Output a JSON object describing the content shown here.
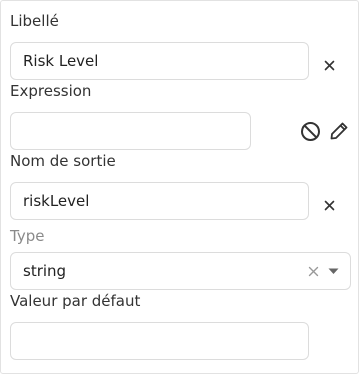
{
  "fields": {
    "label": {
      "title": "Libellé",
      "value": "Risk Level"
    },
    "expression": {
      "title": "Expression",
      "value": ""
    },
    "output_name": {
      "title": "Nom de sortie",
      "value": "riskLevel"
    },
    "type": {
      "title": "Type",
      "selected": "string"
    },
    "default_value": {
      "title": "Valeur par défaut",
      "value": ""
    }
  },
  "icons": {
    "clear_label": "close-icon",
    "disable_expression": "ban-icon",
    "edit_expression": "pencil-icon",
    "clear_output_name": "close-icon",
    "clear_type": "close-icon",
    "open_type": "caret-down-icon"
  },
  "colors": {
    "text": "#333333",
    "muted_label": "#8a8a8a",
    "border": "#dcdcdc",
    "icon": "#333333"
  }
}
